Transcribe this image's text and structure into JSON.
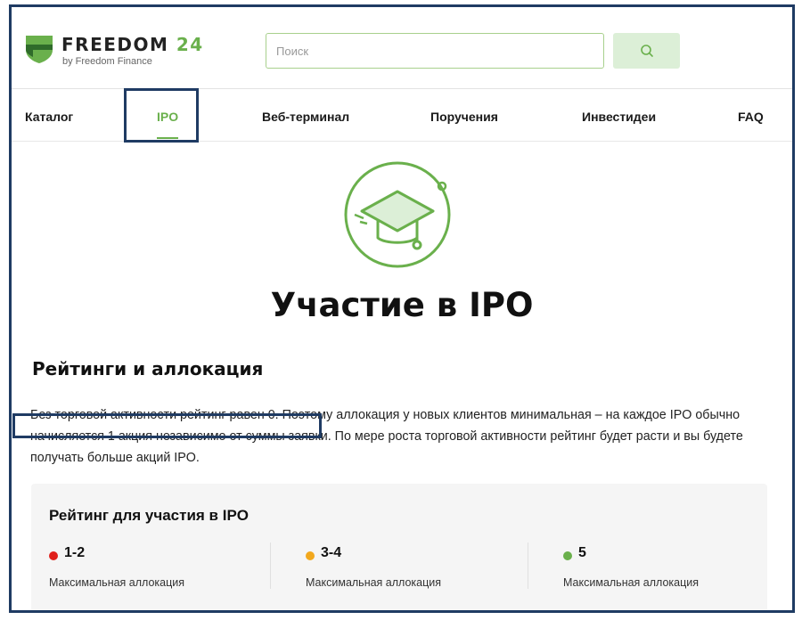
{
  "header": {
    "logo_title": "FREEDOM",
    "logo_number": "24",
    "logo_subtitle": "by Freedom Finance",
    "search_placeholder": "Поиск",
    "search_value": ""
  },
  "nav": {
    "items": [
      {
        "label": "Каталог"
      },
      {
        "label": "IPO",
        "active": true
      },
      {
        "label": "Веб-терминал"
      },
      {
        "label": "Поручения"
      },
      {
        "label": "Инвестидеи"
      },
      {
        "label": "FAQ"
      }
    ]
  },
  "main": {
    "title": "Участие в IPO",
    "hero_icon": "graduation-cap-icon",
    "section_title": "Рейтинги и аллокация",
    "paragraph": "Без торговой активности рейтинг равен 0. Поэтому аллокация у новых клиентов минимальная – на каждое IPO обычно начисляется 1 акция независимо от суммы заявки. По мере роста торговой активности рейтинг будет расти и вы будете получать больше акций IPO."
  },
  "rating": {
    "title": "Рейтинг для участия в IPO",
    "levels": [
      {
        "range": "1-2",
        "description": "Максимальная аллокация",
        "color": "#e0201b"
      },
      {
        "range": "3-4",
        "description": "Максимальная аллокация",
        "color": "#f2a81d"
      },
      {
        "range": "5",
        "description": "Максимальная аллокация",
        "color": "#6ab04c"
      }
    ]
  },
  "colors": {
    "brand_green": "#6ab04c",
    "highlight_border": "#1f3b63"
  }
}
